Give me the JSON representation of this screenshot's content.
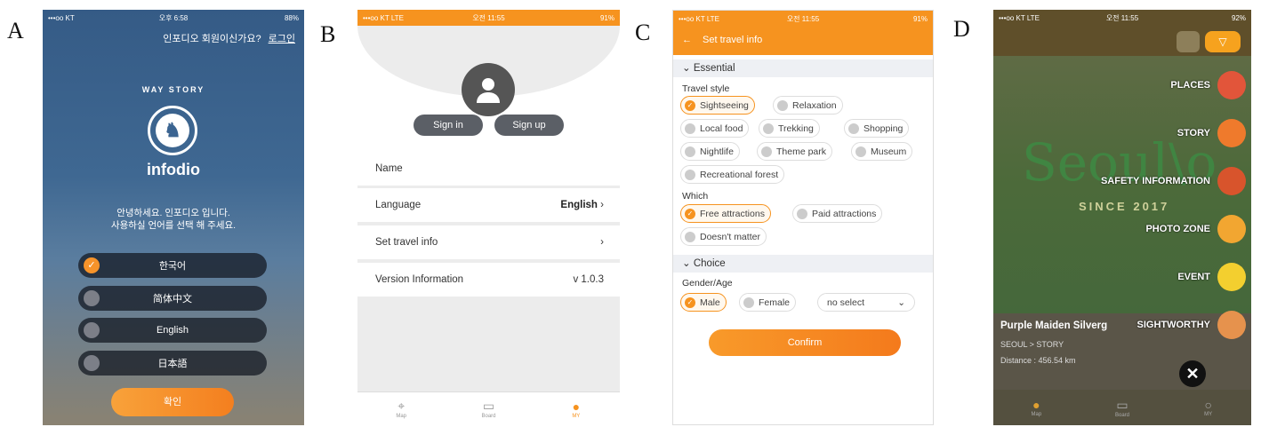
{
  "labels": [
    "A",
    "B",
    "C",
    "D"
  ],
  "panelA": {
    "status": {
      "carrier": "•••oo KT",
      "time": "오후 6:58",
      "battery": "88%"
    },
    "login_question": "인포디오 회원이신가요?",
    "login_link": "로그인",
    "brand": "WAY STORY",
    "app_name": "infodio",
    "greeting_line1": "안녕하세요. 인포디오 입니다.",
    "greeting_line2": "사용하실 언어를 선택 해 주세요.",
    "languages": [
      "한국어",
      "简体中文",
      "English",
      "日本語"
    ],
    "selected_language": "한국어",
    "confirm_label": "확인"
  },
  "panelB": {
    "status": {
      "carrier": "•••oo KT LTE",
      "time": "오전 11:55",
      "battery": "91%"
    },
    "sign_in": "Sign in",
    "sign_up": "Sign up",
    "rows": [
      {
        "label": "Name",
        "value": ""
      },
      {
        "label": "Language",
        "value": "English"
      },
      {
        "label": "Set travel info",
        "value": ""
      },
      {
        "label": "Version Information",
        "value": "v 1.0.3"
      }
    ],
    "tabs": [
      "Map",
      "Board",
      "MY"
    ]
  },
  "panelC": {
    "status": {
      "carrier": "•••oo KT LTE",
      "time": "오전 11:55",
      "battery": "91%"
    },
    "title": "Set travel info",
    "essential": "Essential",
    "travel_style_label": "Travel style",
    "travel_style": [
      "Sightseeing",
      "Relaxation",
      "Local food",
      "Trekking",
      "Shopping",
      "Nightlife",
      "Theme park",
      "Museum",
      "Recreational forest"
    ],
    "which_label": "Which",
    "which": [
      "Free attractions",
      "Paid attractions",
      "Doesn't matter"
    ],
    "choice": "Choice",
    "gender_age_label": "Gender/Age",
    "gender": [
      "Male",
      "Female"
    ],
    "age_select": "no select",
    "confirm_label": "Confirm"
  },
  "panelD": {
    "status": {
      "carrier": "•••oo KT LTE",
      "time": "오전 11:55",
      "battery": "92%"
    },
    "map_text": "Seoul\\o",
    "since": "SINCE 2017",
    "menu": [
      {
        "label": "PLACES",
        "color": "#e2553a"
      },
      {
        "label": "STORY",
        "color": "#ef7a2c"
      },
      {
        "label": "SAFETY INFORMATION",
        "color": "#d8542c"
      },
      {
        "label": "PHOTO ZONE",
        "color": "#f2a631"
      },
      {
        "label": "EVENT",
        "color": "#f3cf2f"
      },
      {
        "label": "SIGHTWORTHY",
        "color": "#e6924d"
      }
    ],
    "card_title": "Purple Maiden Silverg",
    "card_path": "SEOUL > STORY",
    "card_distance": "Distance : 456.54 km",
    "tabs": [
      "Map",
      "Board",
      "MY"
    ]
  }
}
